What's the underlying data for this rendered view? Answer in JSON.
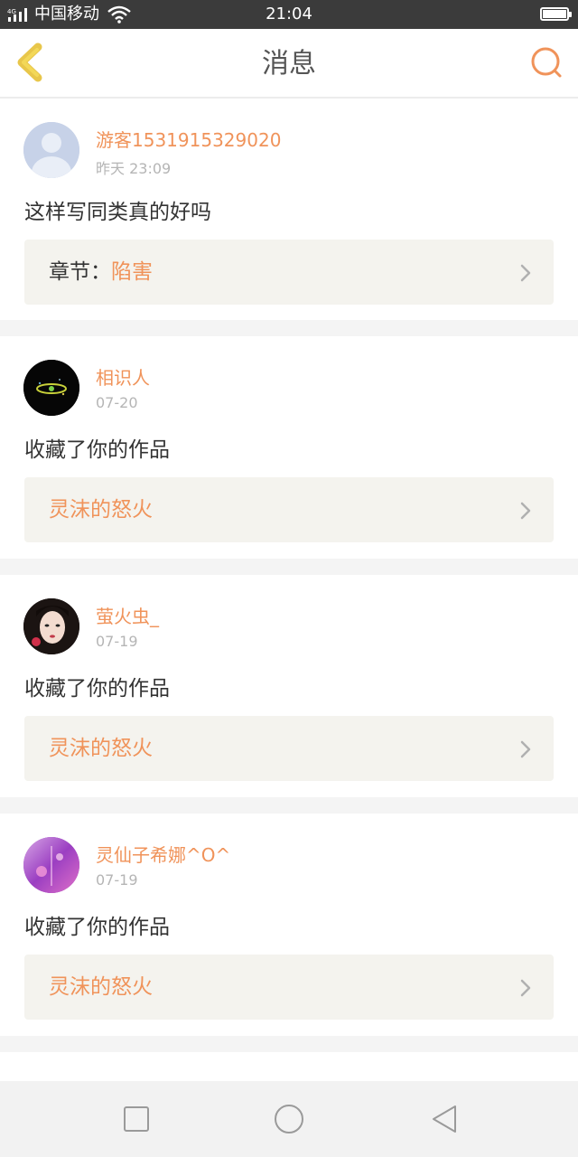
{
  "status_bar": {
    "network": "4G",
    "carrier": "中国移动",
    "time": "21:04",
    "battery_level": 1.0
  },
  "header": {
    "title": "消息",
    "back_icon": "chevron-left-icon",
    "search_icon": "search-icon",
    "accent_color": "#f0935a"
  },
  "messages": [
    {
      "username": "游客1531915329020",
      "time": "昨天 23:09",
      "text": "这样写同类真的好吗",
      "ref_prefix": "章节：",
      "ref_title": "陷害",
      "avatar": "default-avatar-icon"
    },
    {
      "username": "相识人",
      "time": "07-20",
      "text": "收藏了你的作品",
      "ref_prefix": "",
      "ref_title": "灵沫的怒火",
      "avatar": "dark-eye-avatar"
    },
    {
      "username": "萤火虫_",
      "time": "07-19",
      "text": "收藏了你的作品",
      "ref_prefix": "",
      "ref_title": "灵沫的怒火",
      "avatar": "portrait-avatar"
    },
    {
      "username": "灵仙子希娜^O^",
      "time": "07-19",
      "text": "收藏了你的作品",
      "ref_prefix": "",
      "ref_title": "灵沫的怒火",
      "avatar": "purple-avatar"
    }
  ],
  "nav": {
    "recent_icon": "square-icon",
    "home_icon": "circle-icon",
    "back_icon": "triangle-back-icon"
  }
}
